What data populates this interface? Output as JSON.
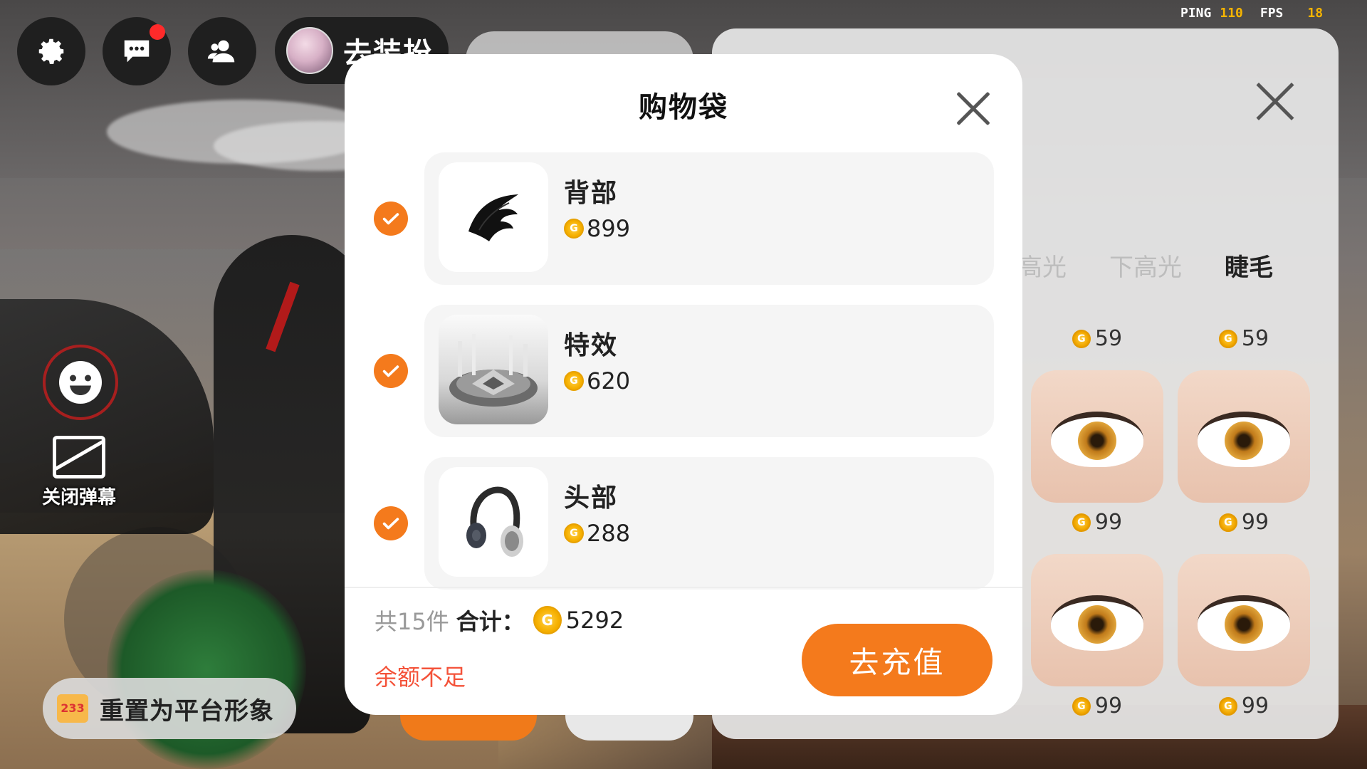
{
  "hud": {
    "dressup_label": "去装扮",
    "ping_label": "PING",
    "ping_value": "110",
    "fps_label": "FPS",
    "fps_value": "18"
  },
  "side": {
    "danmu_label": "关闭弹幕",
    "reset_logo": "233",
    "reset_label": "重置为平台形象"
  },
  "shop": {
    "tabs": [
      "高光",
      "下高光",
      "睫毛"
    ],
    "active_tab": "睫毛",
    "prices": [
      "59",
      "59",
      "99",
      "99",
      "99",
      "99"
    ]
  },
  "cart": {
    "title": "购物袋",
    "items": [
      {
        "name": "背部",
        "price": "899",
        "checked": true,
        "icon": "black-wing-icon"
      },
      {
        "name": "特效",
        "price": "620",
        "checked": true,
        "icon": "effect-platform-icon"
      },
      {
        "name": "头部",
        "price": "288",
        "checked": true,
        "icon": "headphones-icon"
      }
    ],
    "count_text": "共15件",
    "total_label": "合计：",
    "total_value": "5292",
    "insufficient_text": "余额不足",
    "recharge_label": "去充值"
  },
  "colors": {
    "accent": "#f47a1c",
    "warning": "#f4533a",
    "coin": "#f6b000",
    "ping_value": "#f6b400"
  }
}
